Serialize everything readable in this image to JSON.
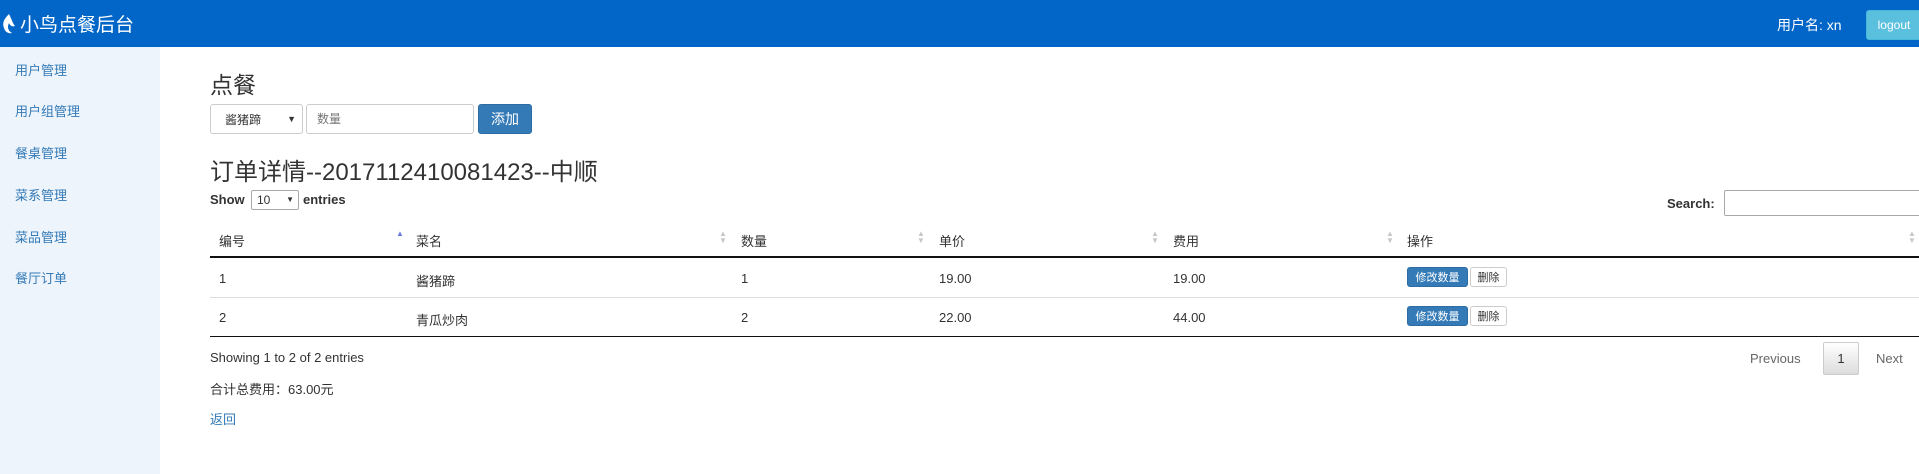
{
  "header": {
    "brand": "小鸟点餐后台",
    "user_label": "用户名: xn",
    "logout_label": "logout"
  },
  "sidebar": {
    "items": [
      {
        "label": "用户管理"
      },
      {
        "label": "用户组管理"
      },
      {
        "label": "餐桌管理"
      },
      {
        "label": "菜系管理"
      },
      {
        "label": "菜品管理"
      },
      {
        "label": "餐厅订单"
      }
    ]
  },
  "order_form": {
    "title": "点餐",
    "dish_selected": "酱猪蹄",
    "quantity_placeholder": "数量",
    "add_label": "添加"
  },
  "order": {
    "title": "订单详情--20171124100814​23--中顺"
  },
  "table_controls": {
    "show_label": "Show",
    "page_length": "10",
    "entries_label": "entries",
    "search_label": "Search:"
  },
  "table": {
    "columns": [
      "编号",
      "菜名",
      "数量",
      "单价",
      "费用",
      "操作"
    ],
    "rows": [
      {
        "id": "1",
        "name": "酱猪蹄",
        "qty": "1",
        "price": "19.00",
        "cost": "19.00",
        "edit_label": "修改数量",
        "delete_label": "删除"
      },
      {
        "id": "2",
        "name": "青瓜炒肉",
        "qty": "2",
        "price": "22.00",
        "cost": "44.00",
        "edit_label": "修改数量",
        "delete_label": "删除"
      }
    ]
  },
  "footer": {
    "info": "Showing 1 to 2 of 2 entries",
    "total": "合计总费用：63.00元",
    "back_label": "返回"
  },
  "pagination": {
    "previous": "Previous",
    "current": "1",
    "next": "Next"
  }
}
